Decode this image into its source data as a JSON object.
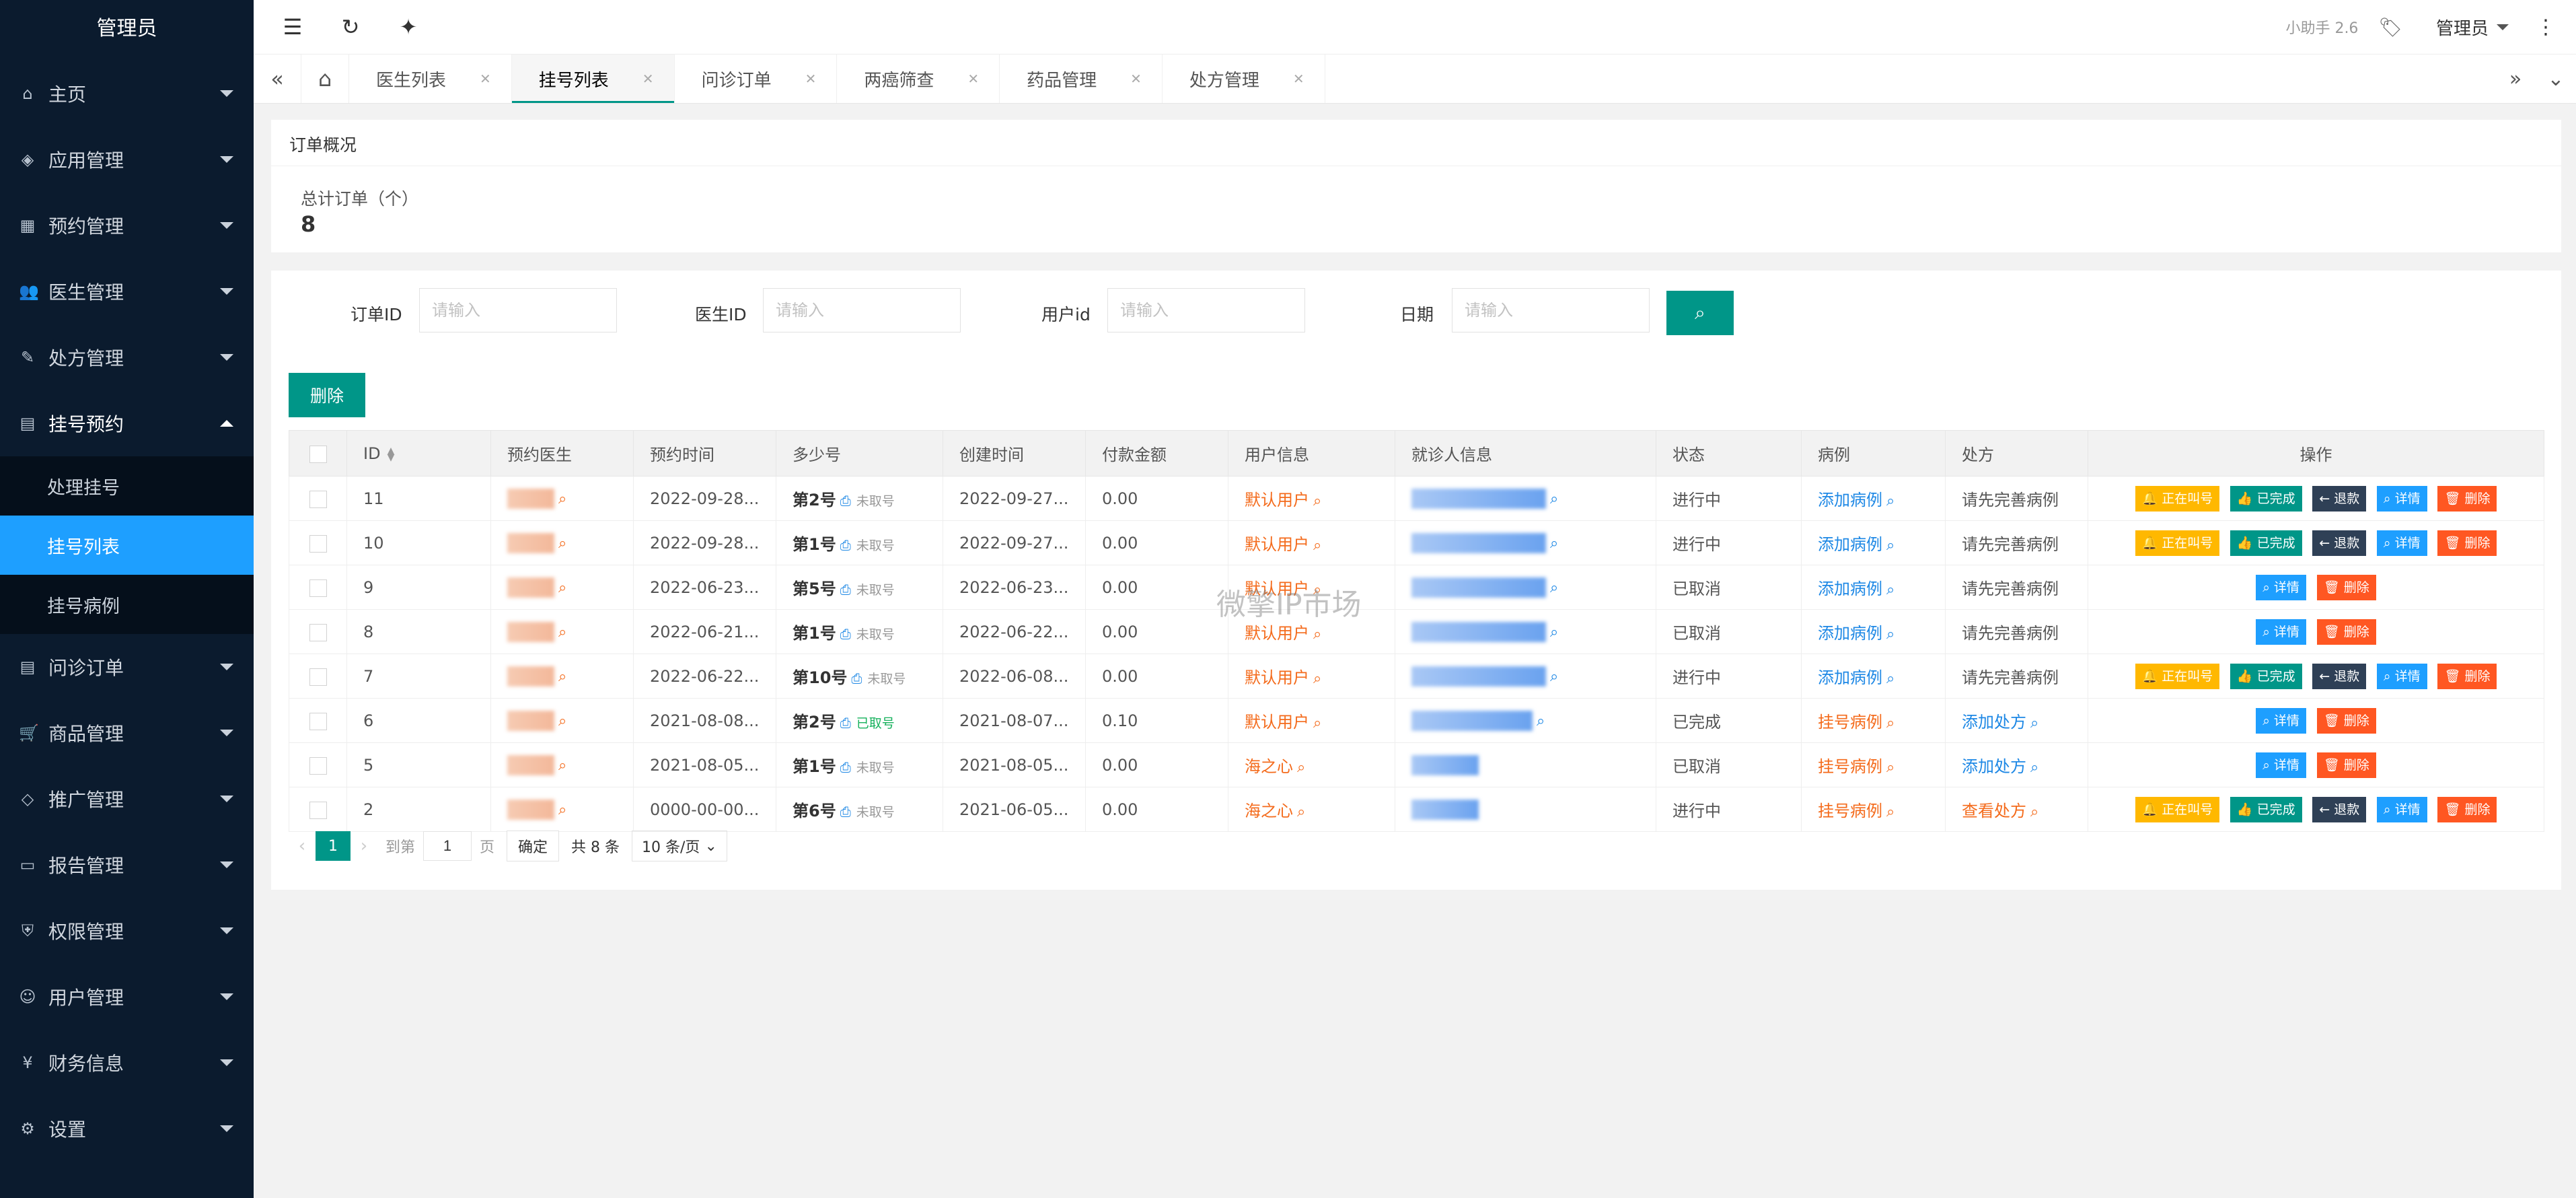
{
  "sidebar": {
    "brand": "管理员",
    "items": [
      {
        "label": "主页",
        "icon": "home-icon"
      },
      {
        "label": "应用管理",
        "icon": "layers-icon"
      },
      {
        "label": "预约管理",
        "icon": "calendar-edit-icon"
      },
      {
        "label": "医生管理",
        "icon": "users-icon"
      },
      {
        "label": "处方管理",
        "icon": "edit-doc-icon"
      },
      {
        "label": "挂号预约",
        "icon": "doc-icon"
      },
      {
        "label": "问诊订单",
        "icon": "doc-icon"
      },
      {
        "label": "商品管理",
        "icon": "cart-icon"
      },
      {
        "label": "推广管理",
        "icon": "diamond-icon"
      },
      {
        "label": "报告管理",
        "icon": "report-icon"
      },
      {
        "label": "权限管理",
        "icon": "shield-check-icon"
      },
      {
        "label": "用户管理",
        "icon": "user-icon"
      },
      {
        "label": "财务信息",
        "icon": "yen-icon"
      },
      {
        "label": "设置",
        "icon": "gear-icon"
      }
    ],
    "sub_items": [
      "处理挂号",
      "挂号列表",
      "挂号病例"
    ]
  },
  "header": {
    "version": "小助手 2.6",
    "user": "管理员"
  },
  "tabs": [
    "医生列表",
    "挂号列表",
    "问诊订单",
    "两癌筛查",
    "药品管理",
    "处方管理"
  ],
  "overview": {
    "title": "订单概况",
    "label": "总计订单（个）",
    "value": "8"
  },
  "filters": {
    "order_id_label": "订单ID",
    "doctor_id_label": "医生ID",
    "user_id_label": "用户id",
    "date_label": "日期",
    "placeholder": "请输入"
  },
  "actions": {
    "delete": "删除"
  },
  "table": {
    "headers": [
      "ID",
      "预约医生",
      "预约时间",
      "多少号",
      "创建时间",
      "付款金额",
      "用户信息",
      "就诊人信息",
      "状态",
      "病例",
      "处方",
      "操作"
    ],
    "rows": [
      {
        "id": "11",
        "time": "2022-09-28...",
        "num": "第2号",
        "ticket": "未取号",
        "created": "2022-09-27...",
        "amount": "0.00",
        "user": "默认用户",
        "status": "进行中",
        "case": "添加病例",
        "rx": "请先完善病例"
      },
      {
        "id": "10",
        "time": "2022-09-28...",
        "num": "第1号",
        "ticket": "未取号",
        "created": "2022-09-27...",
        "amount": "0.00",
        "user": "默认用户",
        "status": "进行中",
        "case": "添加病例",
        "rx": "请先完善病例"
      },
      {
        "id": "9",
        "time": "2022-06-23...",
        "num": "第5号",
        "ticket": "未取号",
        "created": "2022-06-23...",
        "amount": "0.00",
        "user": "默认用户",
        "status": "已取消",
        "case": "添加病例",
        "rx": "请先完善病例"
      },
      {
        "id": "8",
        "time": "2022-06-21...",
        "num": "第1号",
        "ticket": "未取号",
        "created": "2022-06-22...",
        "amount": "0.00",
        "user": "默认用户",
        "status": "已取消",
        "case": "添加病例",
        "rx": "请先完善病例"
      },
      {
        "id": "7",
        "time": "2022-06-22...",
        "num": "第10号",
        "ticket": "未取号",
        "created": "2022-06-08...",
        "amount": "0.00",
        "user": "默认用户",
        "status": "进行中",
        "case": "添加病例",
        "rx": "请先完善病例"
      },
      {
        "id": "6",
        "time": "2021-08-08...",
        "num": "第2号",
        "ticket": "已取号",
        "created": "2021-08-07...",
        "amount": "0.10",
        "user": "默认用户",
        "status": "已完成",
        "case": "挂号病例",
        "rx": "添加处方"
      },
      {
        "id": "5",
        "time": "2021-08-05...",
        "num": "第1号",
        "ticket": "未取号",
        "created": "2021-08-05...",
        "amount": "0.00",
        "user": "海之心",
        "status": "已取消",
        "case": "挂号病例",
        "rx": "添加处方"
      },
      {
        "id": "2",
        "time": "0000-00-00...",
        "num": "第6号",
        "ticket": "未取号",
        "created": "2021-06-05...",
        "amount": "0.00",
        "user": "海之心",
        "status": "进行中",
        "case": "挂号病例",
        "rx": "查看处方"
      }
    ],
    "ops": {
      "calling": "正在叫号",
      "done": "已完成",
      "refund": "退款",
      "detail": "详情",
      "delete": "删除"
    }
  },
  "pager": {
    "current": "1",
    "goto_label": "到第",
    "page_unit": "页",
    "confirm": "确定",
    "total": "共 8 条",
    "per_page": "10 条/页"
  },
  "watermark": "微擎IP市场",
  "colors": {
    "sidebar_bg": "#0b1b2e",
    "active": "#1e9fff",
    "primary": "#009688",
    "orange": "#f46b1c",
    "warn": "#ffb800",
    "danger": "#ff5722"
  }
}
